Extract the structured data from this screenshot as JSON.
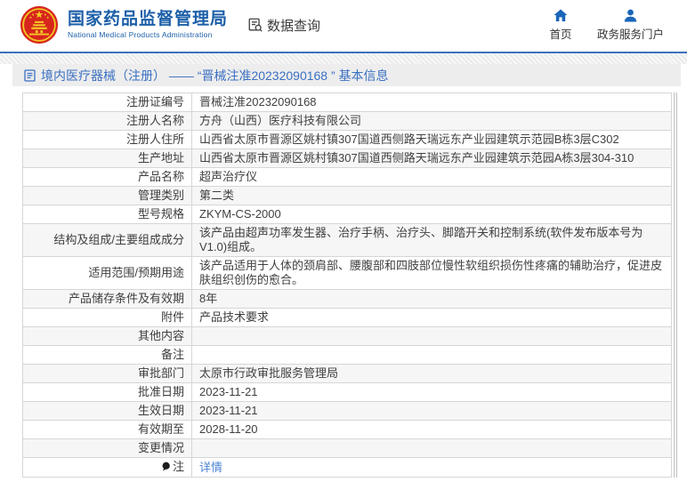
{
  "header": {
    "agency_name_cn": "国家药品监督管理局",
    "agency_name_en": "National Medical Products Administration",
    "data_query_label": "数据查询",
    "home_label": "首页",
    "portal_label": "政务服务门户"
  },
  "breadcrumb": {
    "title": "境内医疗器械（注册） —— “晋械注准20232090168 ” 基本信息"
  },
  "table": {
    "rows": [
      {
        "label": "注册证编号",
        "value": "晋械注准20232090168"
      },
      {
        "label": "注册人名称",
        "value": "方舟（山西）医疗科技有限公司"
      },
      {
        "label": "注册人住所",
        "value": "山西省太原市晋源区姚村镇307国道西侧路天瑞远东产业园建筑示范园B栋3层C302"
      },
      {
        "label": "生产地址",
        "value": "山西省太原市晋源区姚村镇307国道西侧路天瑞远东产业园建筑示范园A栋3层304-310"
      },
      {
        "label": "产品名称",
        "value": "超声治疗仪"
      },
      {
        "label": "管理类别",
        "value": "第二类"
      },
      {
        "label": "型号规格",
        "value": "ZKYM-CS-2000"
      },
      {
        "label": "结构及组成/主要组成成分",
        "value": "该产品由超声功率发生器、治疗手柄、治疗头、脚踏开关和控制系统(软件发布版本号为V1.0)组成。"
      },
      {
        "label": "适用范围/预期用途",
        "value": "该产品适用于人体的颈肩部、腰腹部和四肢部位慢性软组织损伤性疼痛的辅助治疗，促进皮肤组织创伤的愈合。"
      },
      {
        "label": "产品储存条件及有效期",
        "value": "8年"
      },
      {
        "label": "附件",
        "value": "产品技术要求"
      },
      {
        "label": "其他内容",
        "value": ""
      },
      {
        "label": "备注",
        "value": ""
      },
      {
        "label": "审批部门",
        "value": "太原市行政审批服务管理局"
      },
      {
        "label": "批准日期",
        "value": "2023-11-21"
      },
      {
        "label": "生效日期",
        "value": "2023-11-21"
      },
      {
        "label": "有效期至",
        "value": "2028-11-20"
      },
      {
        "label": "变更情况",
        "value": ""
      },
      {
        "label": "注",
        "value": "详情",
        "link": true,
        "icon": "comment-icon"
      }
    ]
  },
  "colors": {
    "brand_blue": "#1c5fa8",
    "header_border_blue": "#3a72bd",
    "breadcrumb_blue": "#3a70c2",
    "link_blue": "#4f86d6",
    "emblem_red": "#d7261d",
    "emblem_gold": "#f3c624"
  }
}
